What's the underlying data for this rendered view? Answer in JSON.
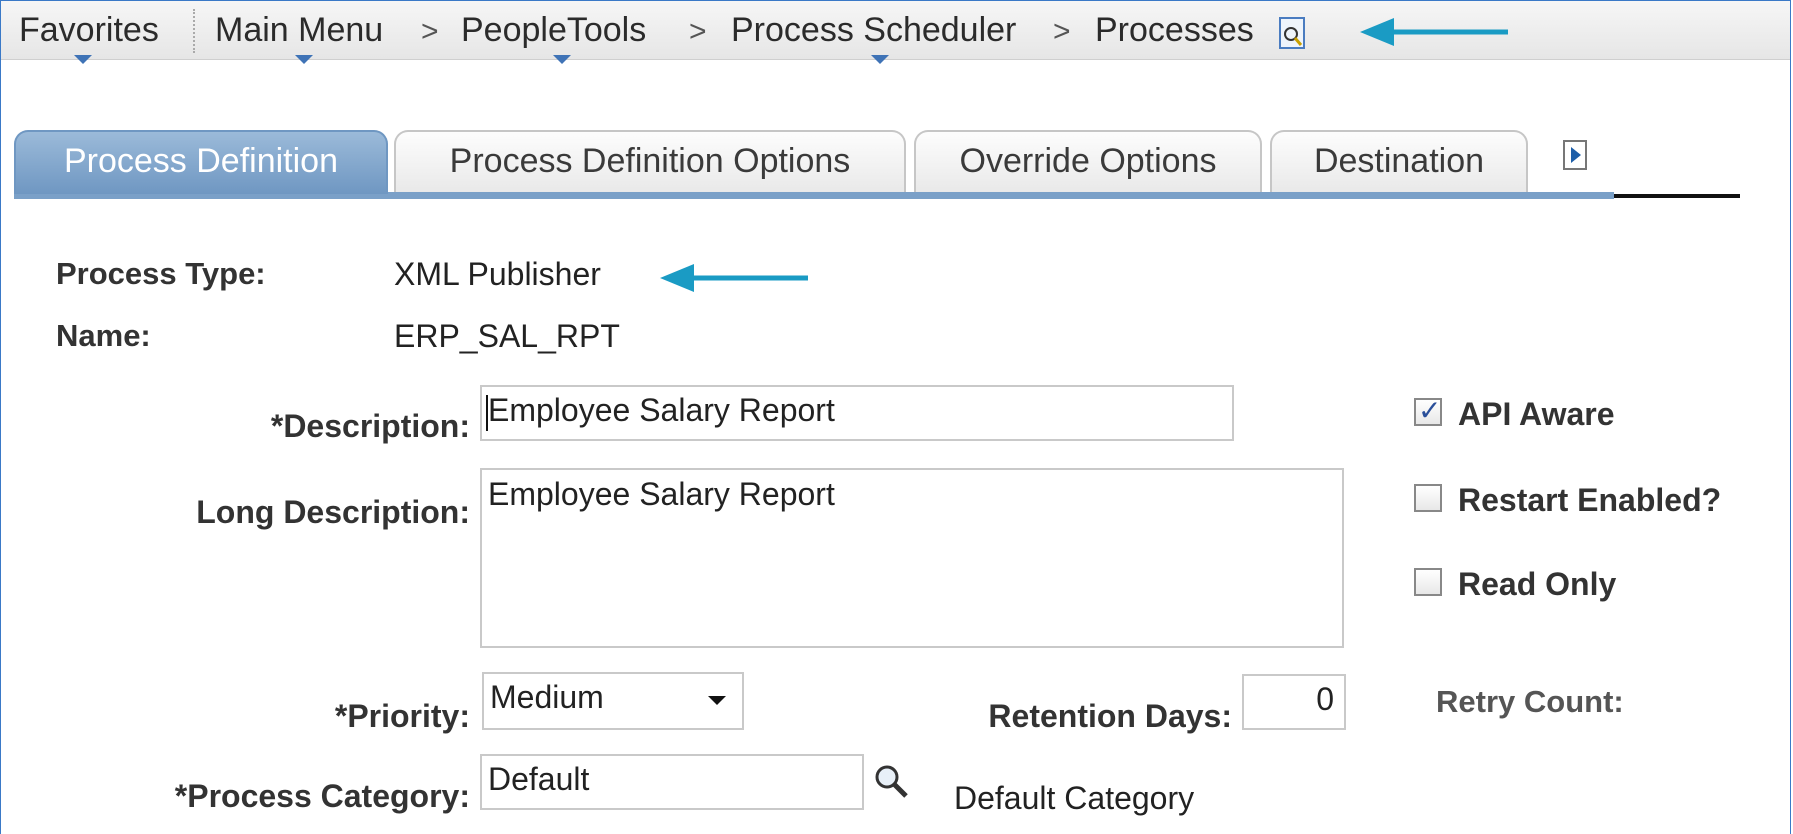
{
  "nav": {
    "favorites": "Favorites",
    "main_menu": "Main Menu",
    "peopletools": "PeopleTools",
    "process_scheduler": "Process Scheduler",
    "processes": "Processes",
    "separator": ">",
    "search_icon": "page-search-icon"
  },
  "tabs": [
    {
      "label": "Process Definition",
      "active": true
    },
    {
      "label": "Process Definition Options",
      "active": false
    },
    {
      "label": "Override Options",
      "active": false
    },
    {
      "label": "Destination",
      "active": false
    }
  ],
  "form": {
    "process_type_label": "Process Type:",
    "process_type_value": "XML Publisher",
    "name_label": "Name:",
    "name_value": "ERP_SAL_RPT",
    "description_label": "*Description:",
    "description_value": "Employee Salary Report",
    "long_description_label": "Long Description:",
    "long_description_value": "Employee Salary Report",
    "priority_label": "*Priority:",
    "priority_value": "Medium",
    "retention_days_label": "Retention Days:",
    "retention_days_value": "0",
    "retry_count_label": "Retry Count:",
    "process_category_label": "*Process Category:",
    "process_category_value": "Default",
    "process_category_description": "Default Category"
  },
  "checkboxes": {
    "api_aware": {
      "label": "API Aware",
      "checked": true
    },
    "restart_enabled": {
      "label": "Restart Enabled?",
      "checked": false
    },
    "read_only": {
      "label": "Read Only",
      "checked": false
    }
  },
  "colors": {
    "annotation_arrow": "#1a9bc4",
    "active_tab": "#7fa4cb",
    "nav_caret": "#3f73b6"
  }
}
